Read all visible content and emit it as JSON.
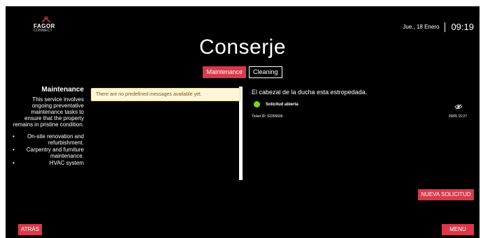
{
  "brand": {
    "name": "FAGOR",
    "sub": "CONNECT",
    "logo_icon": "house-logo-icon"
  },
  "clock": {
    "date": "Jue., 18 Enero",
    "time": "09:19"
  },
  "title": "Conserje",
  "tabs": [
    {
      "label": "Maintenance",
      "active": true
    },
    {
      "label": "Cleaning",
      "active": false
    }
  ],
  "info": {
    "title": "Maintenance",
    "description": "This service involves ongoing preventative maintenance tasks to ensure that the property remains in pristine condition.",
    "items": [
      "On-site renovation and refurbishment.",
      "Carpentry and furniture maintenance.",
      "HVAC system"
    ]
  },
  "messages": {
    "notice": "There are no predefined messages available yet."
  },
  "ticket": {
    "title": "El cabezal de la ducha esta estropedada.",
    "status": "Solicitud abierta",
    "status_color": "#7ed321",
    "ticket_id": "Ticket ID: 52266606",
    "datetime": "29/05 15:27",
    "view_icon": "eye-icon"
  },
  "buttons": {
    "new_request": "NUEVA SOLICITUD",
    "back": "ATRÁS",
    "menu": "MENU"
  },
  "colors": {
    "accent": "#d9394a",
    "background": "#000000",
    "notice_bg": "#fdf6d8"
  }
}
